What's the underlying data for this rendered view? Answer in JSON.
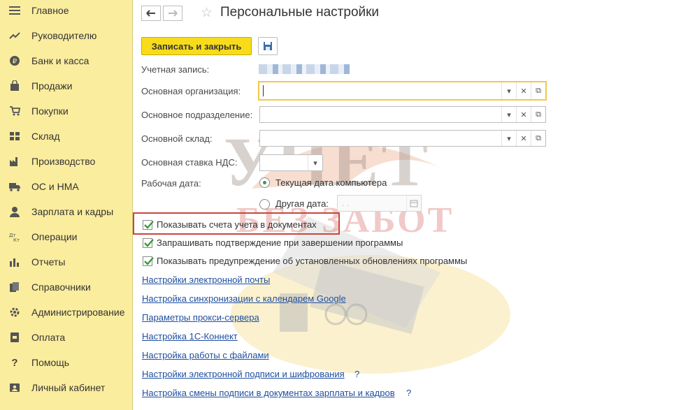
{
  "sidebar": {
    "items": [
      {
        "label": "Главное",
        "icon": "menu-icon"
      },
      {
        "label": "Руководителю",
        "icon": "trend-icon"
      },
      {
        "label": "Банк и касса",
        "icon": "ruble-icon"
      },
      {
        "label": "Продажи",
        "icon": "bag-icon"
      },
      {
        "label": "Покупки",
        "icon": "cart-icon"
      },
      {
        "label": "Склад",
        "icon": "warehouse-icon"
      },
      {
        "label": "Производство",
        "icon": "factory-icon"
      },
      {
        "label": "ОС и НМА",
        "icon": "truck-icon"
      },
      {
        "label": "Зарплата и кадры",
        "icon": "person-icon"
      },
      {
        "label": "Операции",
        "icon": "dt-kt-icon"
      },
      {
        "label": "Отчеты",
        "icon": "bar-chart-icon"
      },
      {
        "label": "Справочники",
        "icon": "books-icon"
      },
      {
        "label": "Администрирование",
        "icon": "gear-icon"
      },
      {
        "label": "Оплата",
        "icon": "payment-icon"
      },
      {
        "label": "Помощь",
        "icon": "question-icon"
      },
      {
        "label": "Личный кабинет",
        "icon": "account-icon"
      }
    ]
  },
  "header": {
    "title": "Персональные настройки"
  },
  "toolbar": {
    "save_close_label": "Записать и закрыть"
  },
  "form": {
    "account_label": "Учетная запись:",
    "org_label": "Основная организация:",
    "dept_label": "Основное подразделение:",
    "warehouse_label": "Основной склад:",
    "vat_label": "Основная ставка НДС:",
    "workdate_label": "Рабочая дата:",
    "radio_current": "Текущая дата компьютера",
    "radio_other": "Другая дата:",
    "date_placeholder": "  .  .",
    "checkboxes": [
      {
        "label": "Показывать счета учета в документах",
        "checked": true
      },
      {
        "label": "Запрашивать подтверждение при завершении программы",
        "checked": true
      },
      {
        "label": "Показывать предупреждение об установленных обновлениях программы",
        "checked": true
      }
    ],
    "links": [
      {
        "label": "Настройки электронной почты"
      },
      {
        "label": "Настройка синхронизации с календарем Google"
      },
      {
        "label": "Параметры прокси-сервера"
      },
      {
        "label": "Настройка 1С-Коннект"
      },
      {
        "label": "Настройка работы с файлами"
      },
      {
        "label": "Настройки электронной подписи и шифрования",
        "help": "?"
      },
      {
        "label": "Настройка смены подписи в документах зарплаты и кадров",
        "help": "?"
      }
    ]
  },
  "watermark": {
    "line1": "УЧЕТ",
    "line2": "БЕЗ ЗАБОТ"
  },
  "colors": {
    "sidebar_bg": "#fbed9e",
    "primary_button": "#f8dc1b",
    "link": "#1f4fa0",
    "highlight": "#c9463d",
    "check": "#3b9a3b"
  }
}
